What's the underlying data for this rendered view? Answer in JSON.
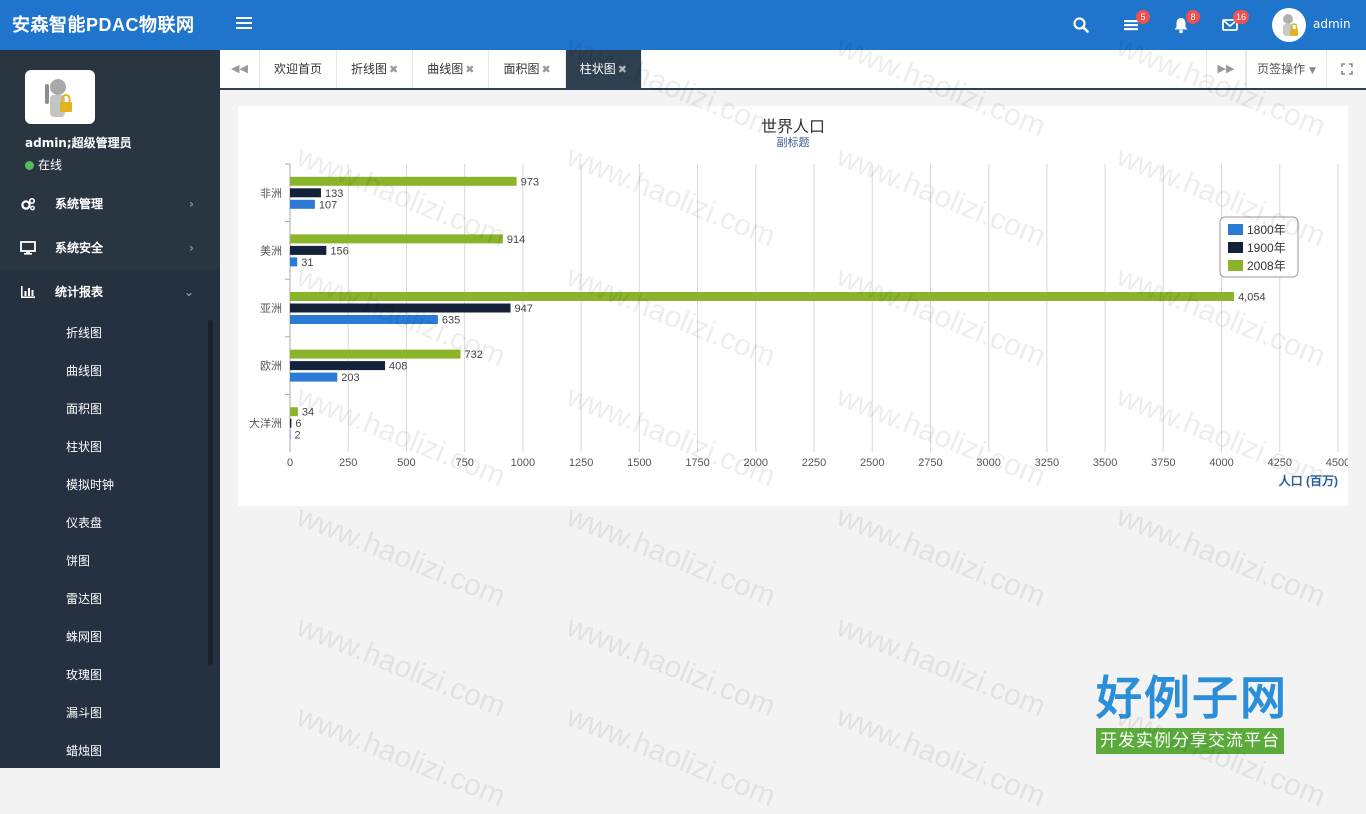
{
  "app": {
    "title": "安森智能PDAC物联网"
  },
  "topbar": {
    "badges": {
      "messages": "5",
      "bell": "8",
      "mail": "16"
    },
    "admin_name": "admin"
  },
  "profile": {
    "name": "admin;超级管理员",
    "status": "在线"
  },
  "sidebar": {
    "menus": [
      {
        "label": "系统管理",
        "icon": "gears-icon"
      },
      {
        "label": "系统安全",
        "icon": "desktop-icon"
      },
      {
        "label": "统计报表",
        "icon": "bar-chart-icon"
      }
    ],
    "sub_items": [
      "折线图",
      "曲线图",
      "面积图",
      "柱状图",
      "模拟时钟",
      "仪表盘",
      "饼图",
      "雷达图",
      "蛛网图",
      "玫瑰图",
      "漏斗图",
      "蜡烛图"
    ]
  },
  "tabs": {
    "items": [
      {
        "label": "欢迎首页",
        "closable": false
      },
      {
        "label": "折线图",
        "closable": true
      },
      {
        "label": "曲线图",
        "closable": true
      },
      {
        "label": "面积图",
        "closable": true
      },
      {
        "label": "柱状图",
        "closable": true,
        "active": true
      }
    ],
    "close_glyph": "✖",
    "tab_ops": "页签操作"
  },
  "chart_data": {
    "type": "bar",
    "orientation": "horizontal",
    "title": "世界人口",
    "subtitle": "副标题",
    "xlabel": "人口 (百万)",
    "categories": [
      "非洲",
      "美洲",
      "亚洲",
      "欧洲",
      "大洋洲"
    ],
    "series": [
      {
        "name": "1800年",
        "color": "#2b7bd6",
        "values": [
          107,
          31,
          635,
          203,
          2
        ],
        "labels": [
          "107",
          "31",
          "635",
          "203",
          "2"
        ]
      },
      {
        "name": "1900年",
        "color": "#132238",
        "values": [
          133,
          156,
          947,
          408,
          6
        ],
        "labels": [
          "133",
          "156",
          "947",
          "408",
          "6"
        ]
      },
      {
        "name": "2008年",
        "color": "#8ab52a",
        "values": [
          973,
          914,
          4054,
          732,
          34
        ],
        "labels": [
          "973",
          "914",
          "4,054",
          "732",
          "34"
        ]
      }
    ],
    "xlim": [
      0,
      4500
    ],
    "ticks": [
      "0",
      "250",
      "500",
      "750",
      "1000",
      "1250",
      "1500",
      "1750",
      "2000",
      "2250",
      "2500",
      "2750",
      "3000",
      "3250",
      "3500",
      "3750",
      "4000",
      "4250",
      "4500"
    ],
    "grid": true,
    "legend": "top-right"
  },
  "watermark": {
    "text": "www.haolizi.com",
    "logo_main": "好例子网",
    "logo_sub": "开发实例分享交流平台"
  }
}
